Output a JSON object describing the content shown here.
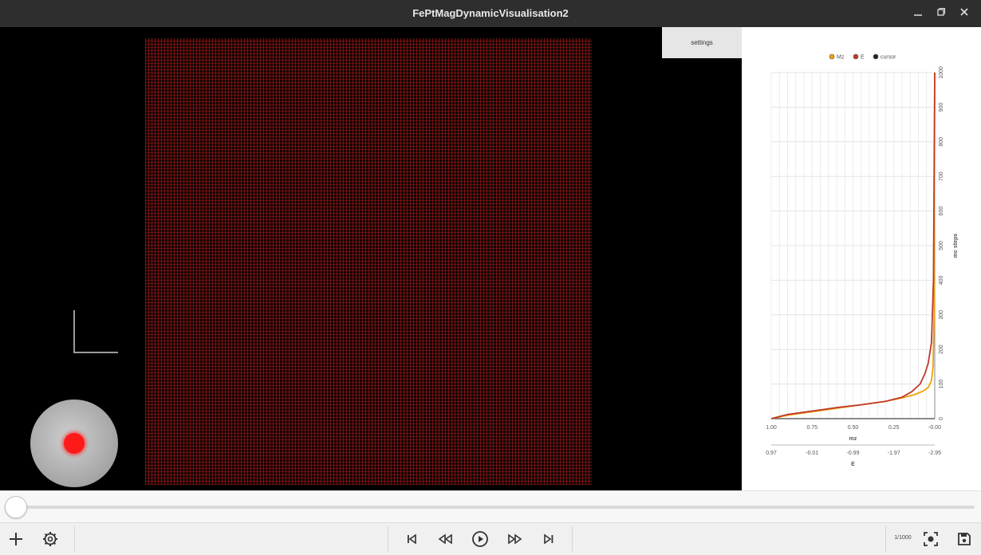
{
  "window": {
    "title": "FePtMagDynamicVisualisation2"
  },
  "window_controls": [
    "minimize-icon",
    "maximize-icon",
    "close-icon"
  ],
  "viewport": {
    "settings_label": "settings",
    "spin_color": "#b41a1a",
    "sphere_dot_color": "#ff1a1a"
  },
  "chart_data": {
    "type": "line",
    "legend": [
      "Mz",
      "E",
      "cursor"
    ],
    "legend_placement": "top",
    "series": [
      {
        "name": "Mz",
        "color": "#f2a300",
        "points": [
          [
            1.0,
            0
          ],
          [
            0.9,
            10
          ],
          [
            0.75,
            20
          ],
          [
            0.6,
            30
          ],
          [
            0.45,
            40
          ],
          [
            0.3,
            50
          ],
          [
            0.2,
            60
          ],
          [
            0.12,
            70
          ],
          [
            0.07,
            80
          ],
          [
            0.04,
            90
          ],
          [
            0.02,
            110
          ],
          [
            0.01,
            150
          ],
          [
            0.004,
            300
          ],
          [
            0.0,
            1000
          ]
        ]
      },
      {
        "name": "E",
        "color": "#c0392b",
        "points": [
          [
            1.0,
            0
          ],
          [
            0.9,
            12
          ],
          [
            0.75,
            22
          ],
          [
            0.6,
            32
          ],
          [
            0.45,
            40
          ],
          [
            0.3,
            50
          ],
          [
            0.2,
            62
          ],
          [
            0.14,
            78
          ],
          [
            0.09,
            100
          ],
          [
            0.06,
            130
          ],
          [
            0.04,
            160
          ],
          [
            0.02,
            220
          ],
          [
            0.008,
            400
          ],
          [
            0.0,
            1000
          ]
        ]
      },
      {
        "name": "cursor",
        "color": "#222222",
        "points": []
      }
    ],
    "x_axis": {
      "label": "mz",
      "ticks": [
        "1.00",
        "0.75",
        "0.50",
        "0.25",
        "-0.00"
      ],
      "range": [
        1.0,
        0.0
      ]
    },
    "x2_axis": {
      "label": "E",
      "ticks": [
        "0.97",
        "-0.01",
        "-0.99",
        "-1.97",
        "-2.95"
      ]
    },
    "y_axis": {
      "label": "mc steps",
      "ticks": [
        "0",
        "100",
        "200",
        "300",
        "400",
        "500",
        "600",
        "700",
        "800",
        "900",
        "1000"
      ],
      "range": [
        0,
        1000
      ]
    },
    "grid": true
  },
  "timeline": {
    "value": 0.0,
    "max": 1000
  },
  "toolbar": {
    "left_icons": [
      "add-icon",
      "gear-icon"
    ],
    "playback_icons": [
      "skip-to-start-icon",
      "rewind-icon",
      "play-icon",
      "fast-forward-icon",
      "skip-to-end-icon"
    ],
    "frame_counter": "1/1000",
    "right_icons": [
      "screenshot-icon",
      "save-icon"
    ]
  }
}
